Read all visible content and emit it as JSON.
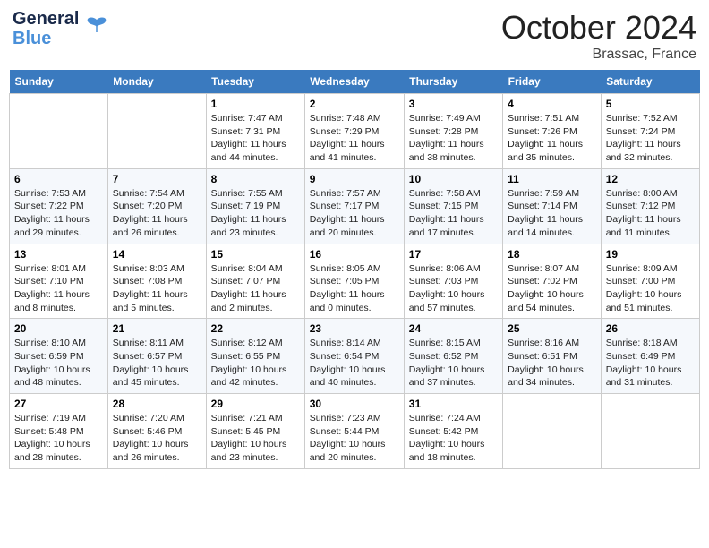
{
  "header": {
    "logo_line1": "General",
    "logo_line2": "Blue",
    "month": "October 2024",
    "location": "Brassac, France"
  },
  "days_of_week": [
    "Sunday",
    "Monday",
    "Tuesday",
    "Wednesday",
    "Thursday",
    "Friday",
    "Saturday"
  ],
  "weeks": [
    [
      {
        "day": "",
        "sunrise": "",
        "sunset": "",
        "daylight": ""
      },
      {
        "day": "",
        "sunrise": "",
        "sunset": "",
        "daylight": ""
      },
      {
        "day": "1",
        "sunrise": "Sunrise: 7:47 AM",
        "sunset": "Sunset: 7:31 PM",
        "daylight": "Daylight: 11 hours and 44 minutes."
      },
      {
        "day": "2",
        "sunrise": "Sunrise: 7:48 AM",
        "sunset": "Sunset: 7:29 PM",
        "daylight": "Daylight: 11 hours and 41 minutes."
      },
      {
        "day": "3",
        "sunrise": "Sunrise: 7:49 AM",
        "sunset": "Sunset: 7:28 PM",
        "daylight": "Daylight: 11 hours and 38 minutes."
      },
      {
        "day": "4",
        "sunrise": "Sunrise: 7:51 AM",
        "sunset": "Sunset: 7:26 PM",
        "daylight": "Daylight: 11 hours and 35 minutes."
      },
      {
        "day": "5",
        "sunrise": "Sunrise: 7:52 AM",
        "sunset": "Sunset: 7:24 PM",
        "daylight": "Daylight: 11 hours and 32 minutes."
      }
    ],
    [
      {
        "day": "6",
        "sunrise": "Sunrise: 7:53 AM",
        "sunset": "Sunset: 7:22 PM",
        "daylight": "Daylight: 11 hours and 29 minutes."
      },
      {
        "day": "7",
        "sunrise": "Sunrise: 7:54 AM",
        "sunset": "Sunset: 7:20 PM",
        "daylight": "Daylight: 11 hours and 26 minutes."
      },
      {
        "day": "8",
        "sunrise": "Sunrise: 7:55 AM",
        "sunset": "Sunset: 7:19 PM",
        "daylight": "Daylight: 11 hours and 23 minutes."
      },
      {
        "day": "9",
        "sunrise": "Sunrise: 7:57 AM",
        "sunset": "Sunset: 7:17 PM",
        "daylight": "Daylight: 11 hours and 20 minutes."
      },
      {
        "day": "10",
        "sunrise": "Sunrise: 7:58 AM",
        "sunset": "Sunset: 7:15 PM",
        "daylight": "Daylight: 11 hours and 17 minutes."
      },
      {
        "day": "11",
        "sunrise": "Sunrise: 7:59 AM",
        "sunset": "Sunset: 7:14 PM",
        "daylight": "Daylight: 11 hours and 14 minutes."
      },
      {
        "day": "12",
        "sunrise": "Sunrise: 8:00 AM",
        "sunset": "Sunset: 7:12 PM",
        "daylight": "Daylight: 11 hours and 11 minutes."
      }
    ],
    [
      {
        "day": "13",
        "sunrise": "Sunrise: 8:01 AM",
        "sunset": "Sunset: 7:10 PM",
        "daylight": "Daylight: 11 hours and 8 minutes."
      },
      {
        "day": "14",
        "sunrise": "Sunrise: 8:03 AM",
        "sunset": "Sunset: 7:08 PM",
        "daylight": "Daylight: 11 hours and 5 minutes."
      },
      {
        "day": "15",
        "sunrise": "Sunrise: 8:04 AM",
        "sunset": "Sunset: 7:07 PM",
        "daylight": "Daylight: 11 hours and 2 minutes."
      },
      {
        "day": "16",
        "sunrise": "Sunrise: 8:05 AM",
        "sunset": "Sunset: 7:05 PM",
        "daylight": "Daylight: 11 hours and 0 minutes."
      },
      {
        "day": "17",
        "sunrise": "Sunrise: 8:06 AM",
        "sunset": "Sunset: 7:03 PM",
        "daylight": "Daylight: 10 hours and 57 minutes."
      },
      {
        "day": "18",
        "sunrise": "Sunrise: 8:07 AM",
        "sunset": "Sunset: 7:02 PM",
        "daylight": "Daylight: 10 hours and 54 minutes."
      },
      {
        "day": "19",
        "sunrise": "Sunrise: 8:09 AM",
        "sunset": "Sunset: 7:00 PM",
        "daylight": "Daylight: 10 hours and 51 minutes."
      }
    ],
    [
      {
        "day": "20",
        "sunrise": "Sunrise: 8:10 AM",
        "sunset": "Sunset: 6:59 PM",
        "daylight": "Daylight: 10 hours and 48 minutes."
      },
      {
        "day": "21",
        "sunrise": "Sunrise: 8:11 AM",
        "sunset": "Sunset: 6:57 PM",
        "daylight": "Daylight: 10 hours and 45 minutes."
      },
      {
        "day": "22",
        "sunrise": "Sunrise: 8:12 AM",
        "sunset": "Sunset: 6:55 PM",
        "daylight": "Daylight: 10 hours and 42 minutes."
      },
      {
        "day": "23",
        "sunrise": "Sunrise: 8:14 AM",
        "sunset": "Sunset: 6:54 PM",
        "daylight": "Daylight: 10 hours and 40 minutes."
      },
      {
        "day": "24",
        "sunrise": "Sunrise: 8:15 AM",
        "sunset": "Sunset: 6:52 PM",
        "daylight": "Daylight: 10 hours and 37 minutes."
      },
      {
        "day": "25",
        "sunrise": "Sunrise: 8:16 AM",
        "sunset": "Sunset: 6:51 PM",
        "daylight": "Daylight: 10 hours and 34 minutes."
      },
      {
        "day": "26",
        "sunrise": "Sunrise: 8:18 AM",
        "sunset": "Sunset: 6:49 PM",
        "daylight": "Daylight: 10 hours and 31 minutes."
      }
    ],
    [
      {
        "day": "27",
        "sunrise": "Sunrise: 7:19 AM",
        "sunset": "Sunset: 5:48 PM",
        "daylight": "Daylight: 10 hours and 28 minutes."
      },
      {
        "day": "28",
        "sunrise": "Sunrise: 7:20 AM",
        "sunset": "Sunset: 5:46 PM",
        "daylight": "Daylight: 10 hours and 26 minutes."
      },
      {
        "day": "29",
        "sunrise": "Sunrise: 7:21 AM",
        "sunset": "Sunset: 5:45 PM",
        "daylight": "Daylight: 10 hours and 23 minutes."
      },
      {
        "day": "30",
        "sunrise": "Sunrise: 7:23 AM",
        "sunset": "Sunset: 5:44 PM",
        "daylight": "Daylight: 10 hours and 20 minutes."
      },
      {
        "day": "31",
        "sunrise": "Sunrise: 7:24 AM",
        "sunset": "Sunset: 5:42 PM",
        "daylight": "Daylight: 10 hours and 18 minutes."
      },
      {
        "day": "",
        "sunrise": "",
        "sunset": "",
        "daylight": ""
      },
      {
        "day": "",
        "sunrise": "",
        "sunset": "",
        "daylight": ""
      }
    ]
  ]
}
